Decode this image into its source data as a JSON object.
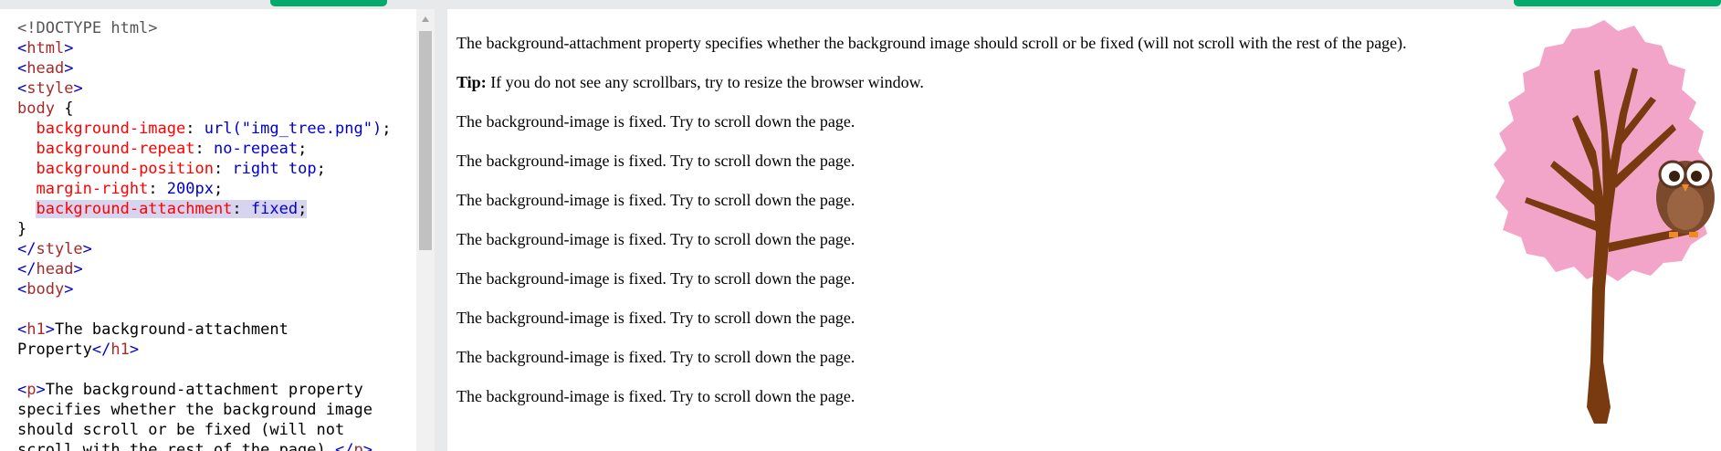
{
  "code_lines": [
    [
      {
        "c": "tok-doctype",
        "t": "<!DOCTYPE html>"
      }
    ],
    [
      {
        "c": "tok-bracket",
        "t": "<"
      },
      {
        "c": "tok-tag",
        "t": "html"
      },
      {
        "c": "tok-bracket",
        "t": ">"
      }
    ],
    [
      {
        "c": "tok-bracket",
        "t": "<"
      },
      {
        "c": "tok-tag",
        "t": "head"
      },
      {
        "c": "tok-bracket",
        "t": ">"
      }
    ],
    [
      {
        "c": "tok-bracket",
        "t": "<"
      },
      {
        "c": "tok-tag",
        "t": "style"
      },
      {
        "c": "tok-bracket",
        "t": ">"
      }
    ],
    [
      {
        "c": "tok-sel",
        "t": "body"
      },
      {
        "c": "tok-text",
        "t": " {"
      }
    ],
    [
      {
        "c": "tok-text",
        "t": "  "
      },
      {
        "c": "tok-prop",
        "t": "background-image"
      },
      {
        "c": "tok-text",
        "t": ": "
      },
      {
        "c": "tok-val",
        "t": "url("
      },
      {
        "c": "tok-str",
        "t": "\"img_tree.png\""
      },
      {
        "c": "tok-val",
        "t": ")"
      },
      {
        "c": "tok-text",
        "t": ";"
      }
    ],
    [
      {
        "c": "tok-text",
        "t": "  "
      },
      {
        "c": "tok-prop",
        "t": "background-repeat"
      },
      {
        "c": "tok-text",
        "t": ": "
      },
      {
        "c": "tok-val",
        "t": "no-repeat"
      },
      {
        "c": "tok-text",
        "t": ";"
      }
    ],
    [
      {
        "c": "tok-text",
        "t": "  "
      },
      {
        "c": "tok-prop",
        "t": "background-position"
      },
      {
        "c": "tok-text",
        "t": ": "
      },
      {
        "c": "tok-val",
        "t": "right top"
      },
      {
        "c": "tok-text",
        "t": ";"
      }
    ],
    [
      {
        "c": "tok-text",
        "t": "  "
      },
      {
        "c": "tok-prop",
        "t": "margin-right"
      },
      {
        "c": "tok-text",
        "t": ": "
      },
      {
        "c": "tok-val",
        "t": "200px"
      },
      {
        "c": "tok-text",
        "t": ";"
      }
    ],
    [
      {
        "c": "tok-text",
        "t": "  "
      },
      {
        "c": "tok-prop hl",
        "t": "background-attachment"
      },
      {
        "c": "tok-text hl",
        "t": ": "
      },
      {
        "c": "tok-val hl",
        "t": "fixed"
      },
      {
        "c": "tok-text hl",
        "t": ";"
      }
    ],
    [
      {
        "c": "tok-text",
        "t": "}"
      }
    ],
    [
      {
        "c": "tok-bracket",
        "t": "</"
      },
      {
        "c": "tok-tag",
        "t": "style"
      },
      {
        "c": "tok-bracket",
        "t": ">"
      }
    ],
    [
      {
        "c": "tok-bracket",
        "t": "</"
      },
      {
        "c": "tok-tag",
        "t": "head"
      },
      {
        "c": "tok-bracket",
        "t": ">"
      }
    ],
    [
      {
        "c": "tok-bracket",
        "t": "<"
      },
      {
        "c": "tok-tag",
        "t": "body"
      },
      {
        "c": "tok-bracket",
        "t": ">"
      }
    ],
    [],
    [
      {
        "c": "tok-bracket",
        "t": "<"
      },
      {
        "c": "tok-tag",
        "t": "h1"
      },
      {
        "c": "tok-bracket",
        "t": ">"
      },
      {
        "c": "tok-text",
        "t": "The background-attachment"
      }
    ],
    [
      {
        "c": "tok-text",
        "t": "Property"
      },
      {
        "c": "tok-bracket",
        "t": "</"
      },
      {
        "c": "tok-tag",
        "t": "h1"
      },
      {
        "c": "tok-bracket",
        "t": ">"
      }
    ],
    [],
    [
      {
        "c": "tok-bracket",
        "t": "<"
      },
      {
        "c": "tok-tag",
        "t": "p"
      },
      {
        "c": "tok-bracket",
        "t": ">"
      },
      {
        "c": "tok-text",
        "t": "The background-attachment property"
      }
    ],
    [
      {
        "c": "tok-text",
        "t": "specifies whether the background image"
      }
    ],
    [
      {
        "c": "tok-text",
        "t": "should scroll or be fixed (will not"
      }
    ],
    [
      {
        "c": "tok-text",
        "t": "scroll with the rest of the page)."
      },
      {
        "c": "tok-bracket",
        "t": "</"
      },
      {
        "c": "tok-tag",
        "t": "p"
      },
      {
        "c": "tok-bracket",
        "t": ">"
      }
    ]
  ],
  "result": {
    "intro": "The background-attachment property specifies whether the background image should scroll or be fixed (will not scroll with the rest of the page).",
    "tip_label": "Tip:",
    "tip_text": " If you do not see any scrollbars, try to resize the browser window.",
    "repeated": [
      "The background-image is fixed. Try to scroll down the page.",
      "The background-image is fixed. Try to scroll down the page.",
      "The background-image is fixed. Try to scroll down the page.",
      "The background-image is fixed. Try to scroll down the page.",
      "The background-image is fixed. Try to scroll down the page.",
      "The background-image is fixed. Try to scroll down the page.",
      "The background-image is fixed. Try to scroll down the page.",
      "The background-image is fixed. Try to scroll down the page."
    ]
  },
  "colors": {
    "accent_green": "#04aa6d",
    "tree_pink": "#f3a5c9",
    "tree_trunk": "#7a3a10",
    "owl_brown": "#7b4a2d"
  }
}
